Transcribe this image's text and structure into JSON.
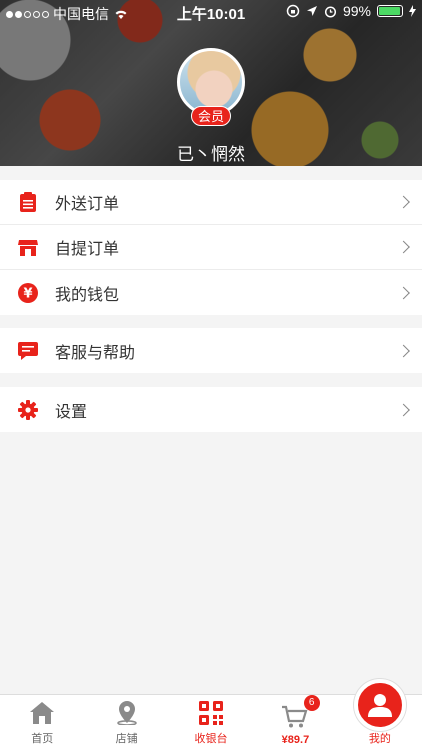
{
  "status_bar": {
    "carrier": "中国电信",
    "time": "上午10:01",
    "battery": "99%"
  },
  "profile": {
    "badge": "会员",
    "username": "已丶惘然"
  },
  "menu": {
    "group1": [
      {
        "label": "外送订单",
        "icon": "clipboard-icon"
      },
      {
        "label": "自提订单",
        "icon": "store-icon"
      },
      {
        "label": "我的钱包",
        "icon": "yen-icon"
      }
    ],
    "group2": [
      {
        "label": "客服与帮助",
        "icon": "chat-icon"
      }
    ],
    "group3": [
      {
        "label": "设置",
        "icon": "gear-icon"
      }
    ]
  },
  "tabbar": {
    "home": "首页",
    "stores": "店铺",
    "cashier": "收银台",
    "cart": "¥89.7",
    "cart_count": "6",
    "mine": "我的"
  },
  "colors": {
    "accent": "#e8231b",
    "background": "#f4f4f4"
  }
}
